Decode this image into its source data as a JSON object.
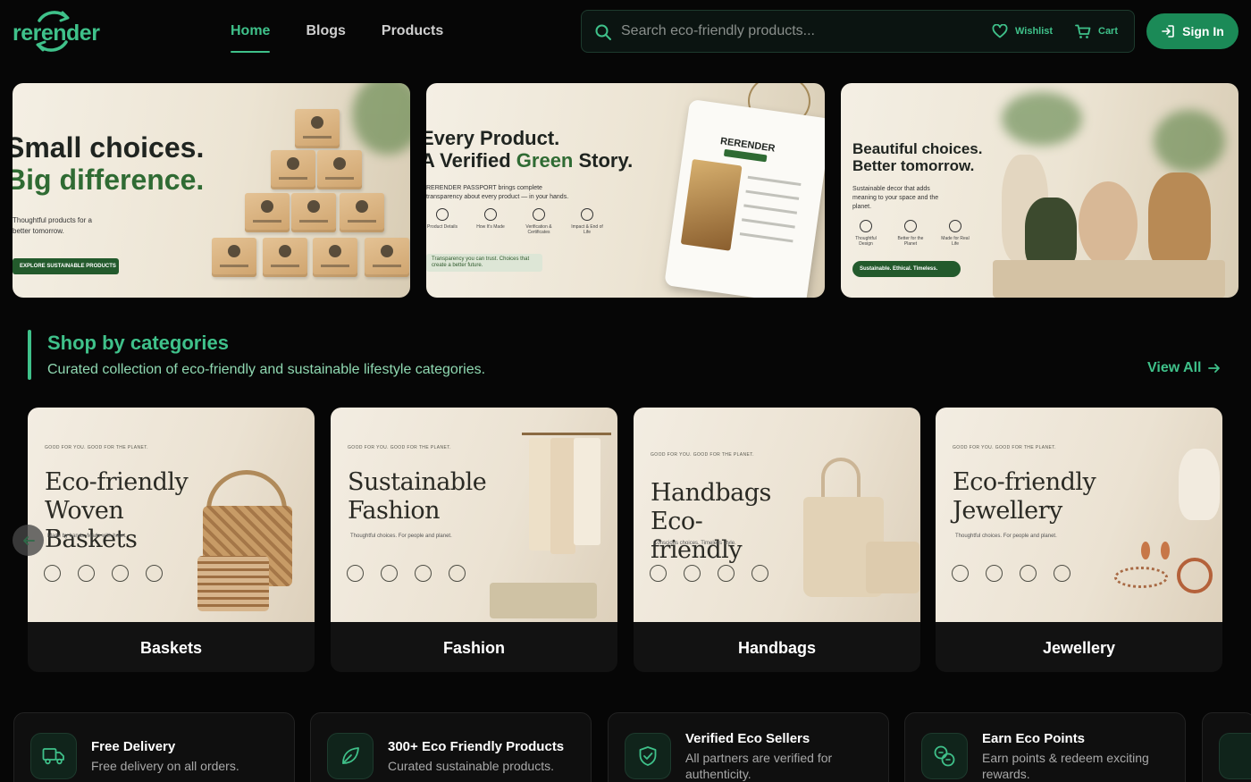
{
  "brand": {
    "name": "rerender",
    "accent": "#3fc18a",
    "button_bg": "#1b8a57"
  },
  "nav": {
    "items": [
      {
        "label": "Home",
        "active": true
      },
      {
        "label": "Blogs",
        "active": false
      },
      {
        "label": "Products",
        "active": false
      }
    ]
  },
  "search": {
    "placeholder": "Search eco-friendly products..."
  },
  "header": {
    "wishlist_label": "Wishlist",
    "cart_label": "Cart",
    "signin_label": "Sign In"
  },
  "banners": [
    {
      "line1": "Small choices.",
      "line2": "Big difference.",
      "subtitle": "Thoughtful products for a better tomorrow.",
      "cta": "EXPLORE SUSTAINABLE PRODUCTS"
    },
    {
      "line1": "Every Product.",
      "line2_prefix": "A Verified ",
      "line2_green": "Green",
      "line2_suffix": " Story.",
      "subtitle": "RERENDER PASSPORT brings complete transparency about every product — in your hands.",
      "icons": [
        "Product Details",
        "How It's Made",
        "Verification & Certificates",
        "Impact & End of Life"
      ],
      "tagline": "Transparency you can trust. Choices that create a better future.",
      "passport_title": "RERENDER"
    },
    {
      "line1": "Beautiful choices.",
      "line2": "Better tomorrow.",
      "subtitle": "Sustainable decor that adds meaning to your space and the planet.",
      "icons": [
        "Thoughtful Design",
        "Better for the Planet",
        "Made for Real Life"
      ],
      "cta": "Sustainable. Ethical. Timeless."
    }
  ],
  "categories": {
    "title": "Shop by categories",
    "subtitle": "Curated collection of eco-friendly and sustainable lifestyle categories.",
    "view_all": "View All",
    "items": [
      {
        "label": "Baskets",
        "small": "GOOD FOR YOU. GOOD FOR THE PLANET.",
        "heading": "Eco-friendly Woven Baskets",
        "desc": "Made by hands. Made with heart."
      },
      {
        "label": "Fashion",
        "small": "GOOD FOR YOU. GOOD FOR THE PLANET.",
        "heading": "Sustainable Fashion",
        "desc": "Thoughtful choices. For people and planet."
      },
      {
        "label": "Handbags",
        "small": "GOOD FOR YOU. GOOD FOR THE PLANET.",
        "heading": "Handbags Eco-friendly",
        "desc": "Conscious choices. Timeless style."
      },
      {
        "label": "Jewellery",
        "small": "GOOD FOR YOU. GOOD FOR THE PLANET.",
        "heading": "Eco-friendly Jewellery",
        "desc": "Thoughtful choices. For people and planet."
      }
    ]
  },
  "features": [
    {
      "title": "Free Delivery",
      "subtitle": "Free delivery on all orders.",
      "icon": "truck-icon"
    },
    {
      "title": "300+ Eco Friendly Products",
      "subtitle": "Curated sustainable products.",
      "icon": "leaf-icon"
    },
    {
      "title": "Verified Eco Sellers",
      "subtitle": "All partners are verified for authenticity.",
      "icon": "shield-check-icon"
    },
    {
      "title": "Earn Eco Points",
      "subtitle": "Earn points & redeem exciting rewards.",
      "icon": "coins-icon"
    }
  ]
}
